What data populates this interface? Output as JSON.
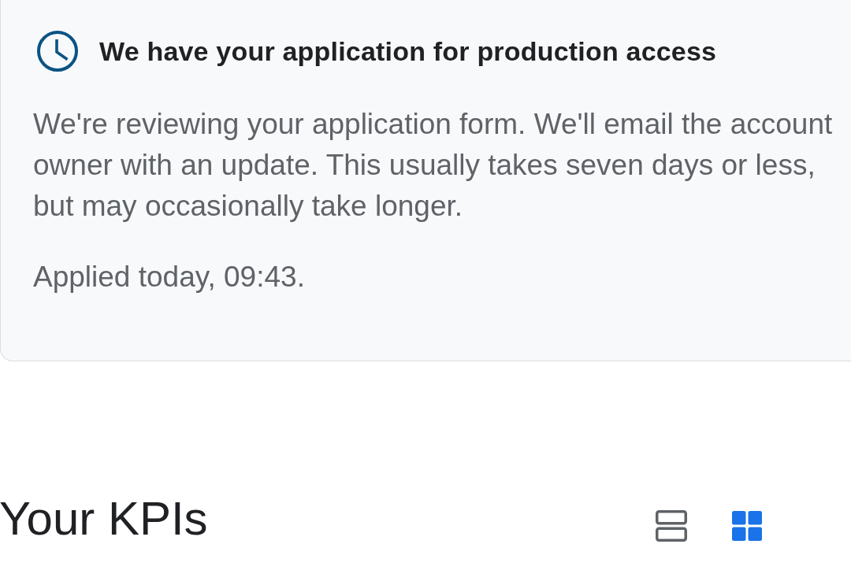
{
  "notice": {
    "title": "We have your application for production access",
    "body": "We're reviewing your application form. We'll email the account owner with an update. This usually takes seven days or less, but may occasionally take longer.",
    "applied": "Applied today, 09:43."
  },
  "kpis": {
    "title": "Your KPIs",
    "view_options": [
      {
        "kind": "list",
        "selected": false
      },
      {
        "kind": "grid",
        "selected": true
      }
    ]
  }
}
